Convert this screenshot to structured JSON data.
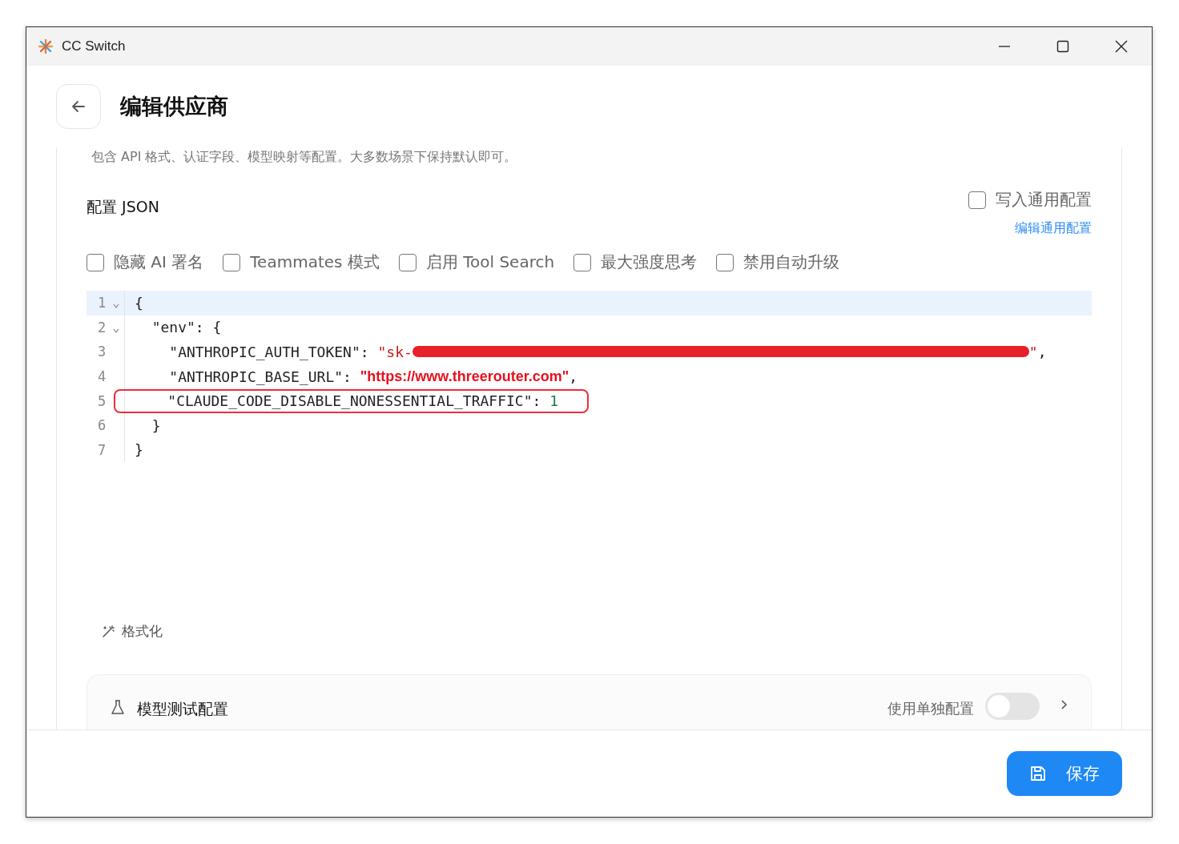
{
  "window": {
    "title": "CC Switch"
  },
  "header": {
    "title": "编辑供应商"
  },
  "description": "包含 API 格式、认证字段、模型映射等配置。大多数场景下保持默认即可。",
  "config": {
    "title": "配置 JSON",
    "write_common": {
      "label": "写入通用配置",
      "checked": false
    },
    "edit_common_link": "编辑通用配置"
  },
  "options": [
    {
      "label": "隐藏 AI 署名",
      "checked": false
    },
    {
      "label": "Teammates 模式",
      "checked": false
    },
    {
      "label": "启用 Tool Search",
      "checked": false
    },
    {
      "label": "最大强度思考",
      "checked": false
    },
    {
      "label": "禁用自动升级",
      "checked": false
    }
  ],
  "editor": {
    "lines": [
      {
        "number": "1",
        "foldable": true,
        "active": true,
        "highlighted": false,
        "tokens": [
          {
            "kind": "punct",
            "text": "{"
          }
        ]
      },
      {
        "number": "2",
        "foldable": true,
        "active": false,
        "highlighted": false,
        "tokens": [
          {
            "kind": "key",
            "text": "  \"env\""
          },
          {
            "kind": "punct",
            "text": ": {"
          }
        ]
      },
      {
        "number": "3",
        "foldable": false,
        "active": false,
        "highlighted": false,
        "tokens": [
          {
            "kind": "key",
            "text": "    \"ANTHROPIC_AUTH_TOKEN\""
          },
          {
            "kind": "punct",
            "text": ": "
          },
          {
            "kind": "string",
            "text": "\"sk-"
          },
          {
            "kind": "redacted"
          },
          {
            "kind": "string",
            "text": "\""
          },
          {
            "kind": "punct",
            "text": ","
          }
        ]
      },
      {
        "number": "4",
        "foldable": false,
        "active": false,
        "highlighted": false,
        "tokens": [
          {
            "kind": "key",
            "text": "    \"ANTHROPIC_BASE_URL\""
          },
          {
            "kind": "punct",
            "text": ": "
          },
          {
            "kind": "url",
            "text": "\"https://www.threerouter.com\""
          },
          {
            "kind": "punct",
            "text": ","
          }
        ]
      },
      {
        "number": "5",
        "foldable": false,
        "active": false,
        "highlighted": true,
        "tokens": [
          {
            "kind": "key",
            "text": "    \"CLAUDE_CODE_DISABLE_NONESSENTIAL_TRAFFIC\""
          },
          {
            "kind": "punct",
            "text": ": "
          },
          {
            "kind": "number",
            "text": "1"
          }
        ]
      },
      {
        "number": "6",
        "foldable": false,
        "active": false,
        "highlighted": false,
        "tokens": [
          {
            "kind": "punct",
            "text": "  }"
          }
        ]
      },
      {
        "number": "7",
        "foldable": false,
        "active": false,
        "highlighted": false,
        "tokens": [
          {
            "kind": "punct",
            "text": "}"
          }
        ]
      }
    ]
  },
  "format_button": "格式化",
  "test_card": {
    "title": "模型测试配置",
    "toggle_label": "使用单独配置",
    "on": false
  },
  "save_button": "保存"
}
